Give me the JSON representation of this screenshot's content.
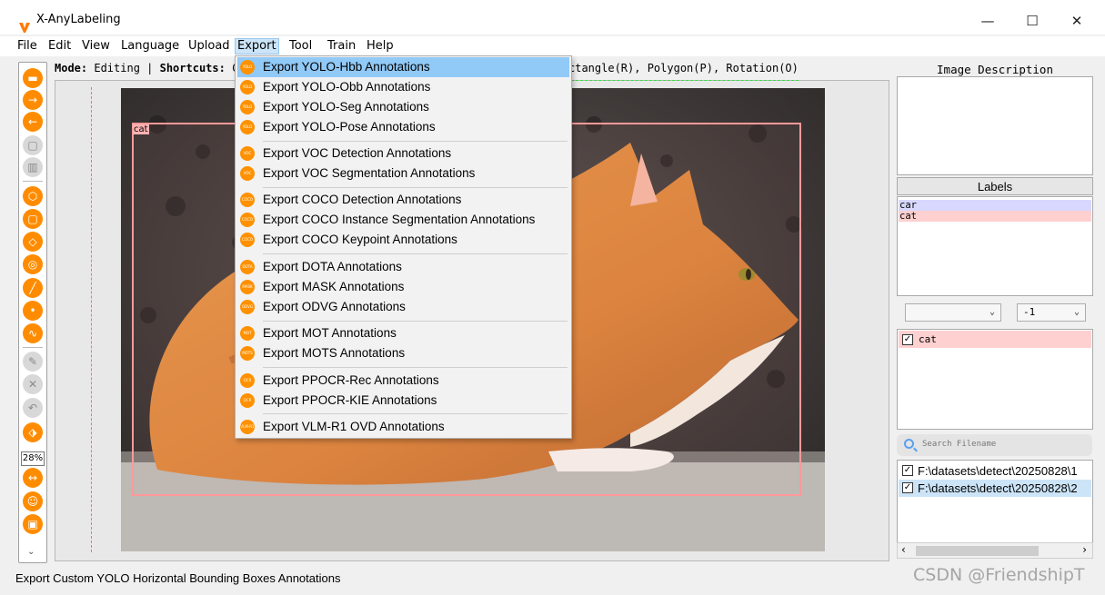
{
  "window": {
    "title": "X-AnyLabeling",
    "minimize": "—",
    "maximize": "☐",
    "close": "✕"
  },
  "menubar": [
    "File",
    "Edit",
    "View",
    "Language",
    "Upload",
    "Export",
    "Tool",
    "Train",
    "Help"
  ],
  "mode_line": {
    "mode_label": "Mode:",
    "mode_value": " Editing | ",
    "shortcuts_label": "Shortcuts:",
    "shortcuts_prefix": " C",
    "shortcuts_rest": "ctangle(R), Polygon(P), Rotation(O)"
  },
  "zoom": "28%",
  "canvas": {
    "box_label": "cat"
  },
  "export_menu": {
    "items": [
      {
        "icon": "YOLO",
        "label": "Export YOLO-Hbb Annotations"
      },
      {
        "icon": "YOLO",
        "label": "Export YOLO-Obb Annotations"
      },
      {
        "icon": "YOLO",
        "label": "Export YOLO-Seg Annotations"
      },
      {
        "icon": "YOLO",
        "label": "Export YOLO-Pose Annotations"
      },
      {
        "icon": "VOC",
        "label": "Export VOC Detection Annotations"
      },
      {
        "icon": "VOC",
        "label": "Export VOC Segmentation Annotations"
      },
      {
        "icon": "COCO",
        "label": "Export COCO Detection Annotations"
      },
      {
        "icon": "COCO",
        "label": "Export COCO Instance Segmentation Annotations"
      },
      {
        "icon": "COCO",
        "label": "Export COCO Keypoint Annotations"
      },
      {
        "icon": "DOTA",
        "label": "Export DOTA Annotations"
      },
      {
        "icon": "MASK",
        "label": "Export MASK Annotations"
      },
      {
        "icon": "ODVG",
        "label": "Export ODVG Annotations"
      },
      {
        "icon": "MOT",
        "label": "Export MOT Annotations"
      },
      {
        "icon": "MOTS",
        "label": "Export MOTS Annotations"
      },
      {
        "icon": "OCR",
        "label": "Export PPOCR-Rec Annotations"
      },
      {
        "icon": "OCR",
        "label": "Export PPOCR-KIE Annotations"
      },
      {
        "icon": "VLM-R1",
        "label": "Export VLM-R1 OVD Annotations"
      }
    ]
  },
  "right_panel": {
    "image_description_title": "Image Description",
    "labels_title": "Labels",
    "labels": [
      {
        "name": "car",
        "color": "#d8d8ff"
      },
      {
        "name": "cat",
        "color": "#ffd0d0"
      }
    ],
    "combo_left_value": "",
    "combo_right_value": "-1",
    "shape_list": [
      {
        "name": "cat",
        "checked": true
      }
    ],
    "search_placeholder": "Search Filename",
    "files": [
      {
        "path": "F:\\datasets\\detect\\20250828\\1",
        "checked": true
      },
      {
        "path": "F:\\datasets\\detect\\20250828\\2",
        "checked": true
      }
    ]
  },
  "status": "Export Custom YOLO Horizontal Bounding Boxes Annotations",
  "watermark": "CSDN @FriendshipT"
}
